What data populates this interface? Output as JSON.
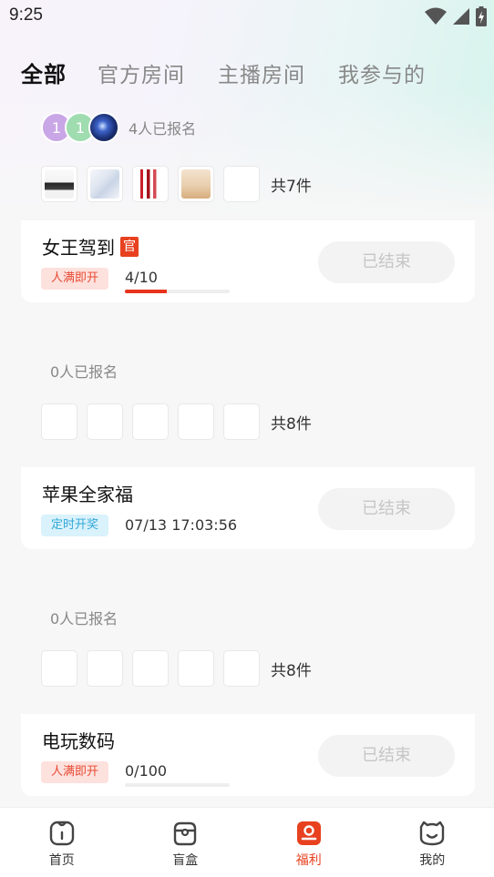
{
  "status_bar": {
    "time": "9:25"
  },
  "tabs": [
    {
      "label": "全部",
      "active": true
    },
    {
      "label": "官方房间",
      "active": false
    },
    {
      "label": "主播房间",
      "active": false
    },
    {
      "label": "我参与的",
      "active": false
    }
  ],
  "events": [
    {
      "avatars": [
        "1",
        "1"
      ],
      "signup_text": "4人已报名",
      "prize_total": "共7件",
      "title": "女王驾到",
      "official_badge": "官",
      "tag": "人满即开",
      "progress_text": "4/10",
      "progress_fraction": 0.4,
      "button": "已结束"
    },
    {
      "signup_text": "0人已报名",
      "prize_total": "共8件",
      "title": "苹果全家福",
      "tag": "定时开奖",
      "time_text": "07/13 17:03:56",
      "button": "已结束"
    },
    {
      "signup_text": "0人已报名",
      "prize_total": "共8件",
      "title": "电玩数码",
      "tag": "人满即开",
      "progress_text": "0/100",
      "progress_fraction": 0,
      "button": "已结束"
    }
  ],
  "bottom_nav": [
    {
      "label": "首页",
      "icon": "home-icon",
      "active": false
    },
    {
      "label": "盲盒",
      "icon": "blind-box-icon",
      "active": false
    },
    {
      "label": "福利",
      "icon": "welfare-icon",
      "active": true
    },
    {
      "label": "我的",
      "icon": "profile-icon",
      "active": false
    }
  ],
  "colors": {
    "accent": "#e8411f",
    "progress": "#e8341c",
    "tag_red_bg": "#fde1dd",
    "tag_blue_bg": "#d9f2fb"
  }
}
